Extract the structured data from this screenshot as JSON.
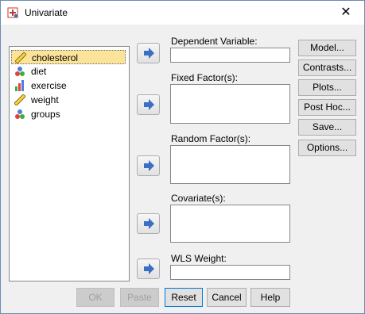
{
  "window": {
    "title": "Univariate",
    "close_glyph": "✕"
  },
  "variables": [
    {
      "label": "cholesterol",
      "icon": "scale-ruler-icon",
      "selected": true
    },
    {
      "label": "diet",
      "icon": "nominal-icon",
      "selected": false
    },
    {
      "label": "exercise",
      "icon": "ordinal-icon",
      "selected": false
    },
    {
      "label": "weight",
      "icon": "scale-ruler-icon",
      "selected": false
    },
    {
      "label": "groups",
      "icon": "nominal-icon",
      "selected": false
    }
  ],
  "fields": {
    "dependent_variable": {
      "label": "Dependent Variable:",
      "value": ""
    },
    "fixed_factors": {
      "label": "Fixed Factor(s):",
      "value": ""
    },
    "random_factors": {
      "label": "Random Factor(s):",
      "value": ""
    },
    "covariates": {
      "label": "Covariate(s):",
      "value": ""
    },
    "wls_weight": {
      "label": "WLS Weight:",
      "value": ""
    }
  },
  "side_buttons": {
    "model": "Model...",
    "contrasts": "Contrasts...",
    "plots": "Plots...",
    "post_hoc": "Post Hoc...",
    "save": "Save...",
    "options": "Options..."
  },
  "bottom_buttons": {
    "ok": "OK",
    "paste": "Paste",
    "reset": "Reset",
    "cancel": "Cancel",
    "help": "Help"
  },
  "colors": {
    "selection": "#fbe49a",
    "arrow_blue": "#3a6fc4"
  }
}
